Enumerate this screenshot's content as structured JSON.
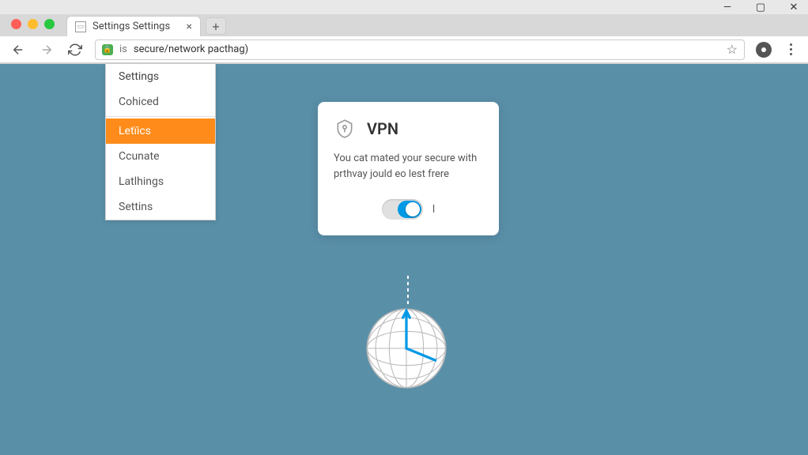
{
  "window": {
    "minimize": "—",
    "maximize": "▢",
    "close": "✕"
  },
  "tab": {
    "title": "Settings Settings"
  },
  "address": {
    "secure_prefix": "is",
    "url": "secure/network pacthag)"
  },
  "menu": {
    "items": [
      {
        "label": "Settings",
        "active": false
      },
      {
        "label": "Cohiced",
        "active": false
      },
      {
        "label": "Letïics",
        "active": true
      },
      {
        "label": "Ccunate",
        "active": false
      },
      {
        "label": "Latlhings",
        "active": false
      },
      {
        "label": "Settins",
        "active": false
      }
    ]
  },
  "vpn": {
    "title": "VPN",
    "description": "You cat mated your secure with prthvay jould eo lest frere",
    "toggle_state": "on",
    "toggle_label": "I"
  }
}
